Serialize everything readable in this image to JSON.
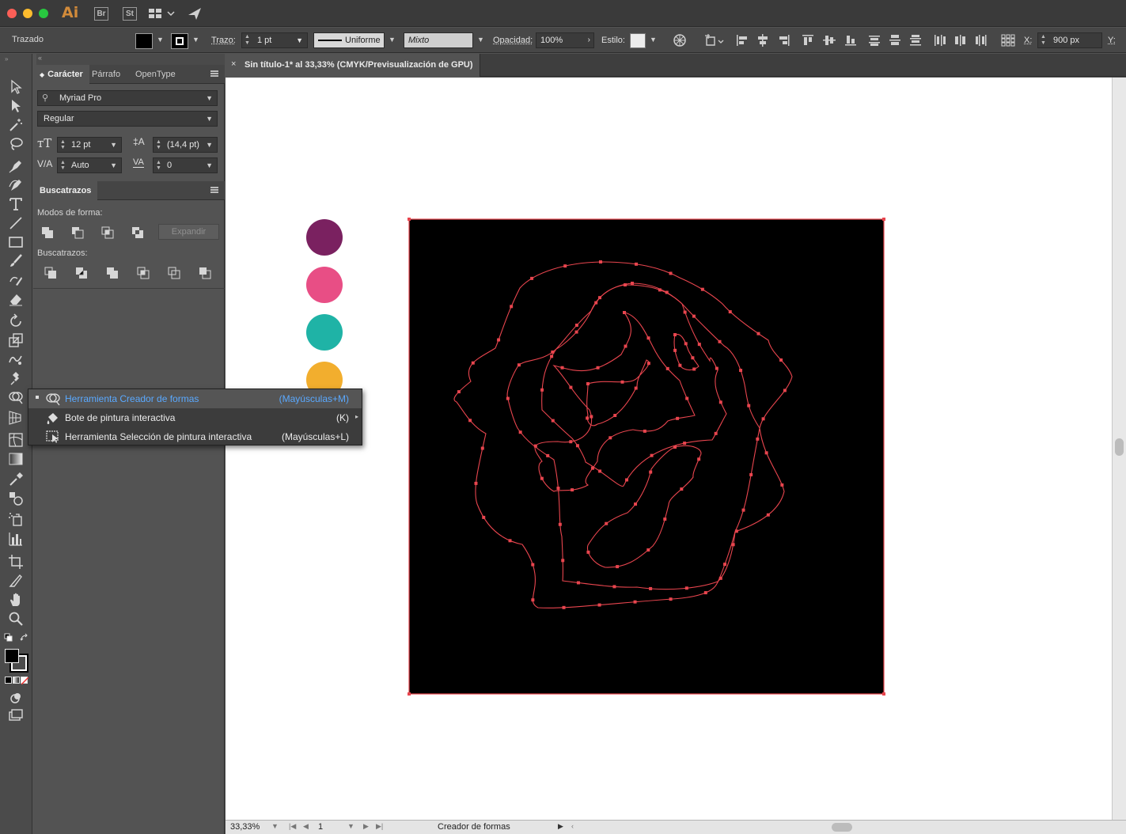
{
  "titlebar": {
    "app_logo": "Ai",
    "bridge_label": "Br",
    "stock_label": "St",
    "icons": [
      "workspace-switcher-icon",
      "publish-plane-icon"
    ]
  },
  "control_bar": {
    "selection_label": "Trazado",
    "stroke_label": "Trazo:",
    "stroke_weight": "1 pt",
    "stroke_profile": "Uniforme",
    "brush_value": "Mixto",
    "opacity_label": "Opacidad:",
    "opacity_value": "100%",
    "style_label": "Estilo:",
    "x_label": "X:",
    "x_value": "900 px",
    "y_label": "Y:"
  },
  "panel": {
    "tabs": [
      "Carácter",
      "Párrafo",
      "OpenType"
    ],
    "font_family": "Myriad Pro",
    "font_style": "Regular",
    "font_size": "12 pt",
    "leading": "(14,4 pt)",
    "kerning": "Auto",
    "tracking": "0",
    "pathfinder_title": "Buscatrazos",
    "shape_modes_label": "Modos de forma:",
    "expand_label": "Expandir",
    "pathfinders_label": "Buscatrazos:"
  },
  "document": {
    "tab_title": "Sin título-1* al 33,33% (CMYK/Previsualización de GPU)",
    "close_glyph": "×"
  },
  "swatches": [
    {
      "name": "purple-swatch",
      "color": "#7a2160"
    },
    {
      "name": "pink-swatch",
      "color": "#e84e85"
    },
    {
      "name": "teal-swatch",
      "color": "#1fb3a6"
    },
    {
      "name": "orange-swatch",
      "color": "#f2ae2e"
    }
  ],
  "artwork": {
    "background_color": "#000000",
    "path_color": "#e8454e"
  },
  "flyout": {
    "items": [
      {
        "label": "Herramienta Creador de formas",
        "shortcut": "(Mayúsculas+M)",
        "selected": true
      },
      {
        "label": "Bote de pintura interactiva",
        "shortcut": "(K)",
        "selected": false
      },
      {
        "label": "Herramienta Selección de pintura interactiva",
        "shortcut": "(Mayúsculas+L)",
        "selected": false
      }
    ]
  },
  "status_bar": {
    "zoom": "33,33%",
    "page": "1",
    "tool_name": "Creador de formas"
  }
}
